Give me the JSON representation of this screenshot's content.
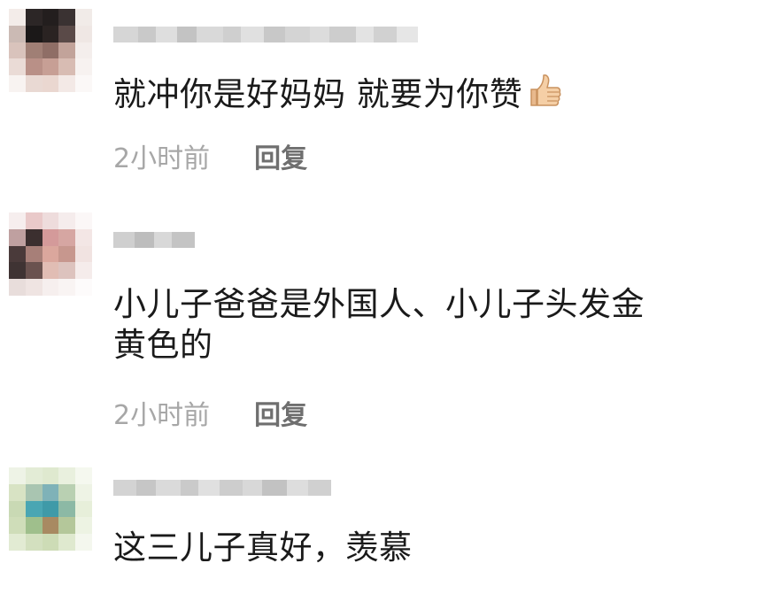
{
  "comments": [
    {
      "text": "就冲你是好妈妈 就要为你赞",
      "emoji": "thumbs-up-icon",
      "time": "2小时前",
      "reply_label": "回复"
    },
    {
      "text_line1": "小儿子爸爸是外国人、小儿子头发金",
      "text_line2": "黄色的",
      "time": "2小时前",
      "reply_label": "回复"
    },
    {
      "text": "这三儿子真好，羡慕"
    }
  ],
  "colors": {
    "time": "#a7a7a7",
    "reply": "#6f6f6f",
    "text": "#1a1a1a"
  }
}
